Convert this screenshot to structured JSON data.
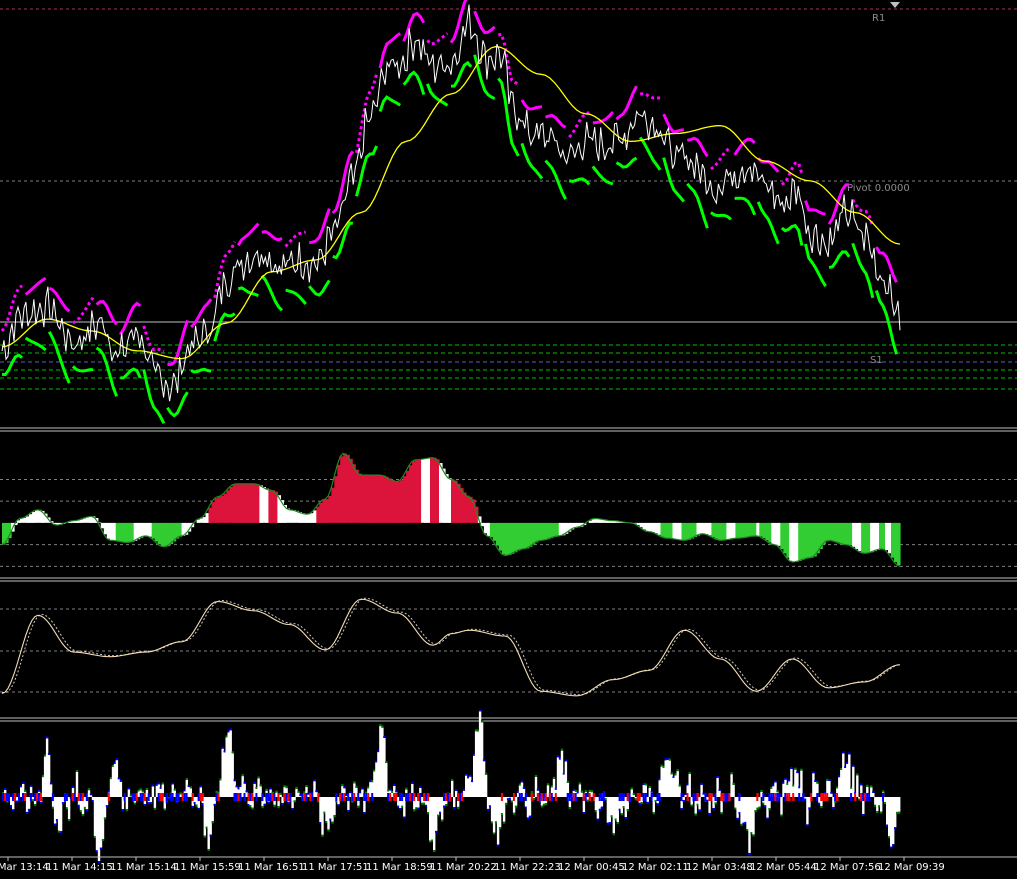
{
  "window": {
    "corner_marker_color": "#c0c0c0"
  },
  "colors": {
    "background": "#000000",
    "price": "#ffffff",
    "ma": "#ffff00",
    "band_up": "#00ff00",
    "band_down": "#ff00ff",
    "osc_pos": "#dc143c",
    "osc_neg": "#32cd32",
    "osc_neutral": "#ffffff",
    "signal_line": "#f5deb3",
    "hist_pos": "#ff0000",
    "hist_neg": "#0000ff",
    "hist_edge": "#008000",
    "grid": "#808080",
    "pivot_dash": "#00c000",
    "separator": "#c0c0c0"
  },
  "chart_data": [
    {
      "type": "line",
      "name": "main-price-panel",
      "levels": [
        {
          "label": "R1"
        },
        {
          "label": "Pivot 0.0000"
        },
        {
          "label": "S1"
        }
      ],
      "x_ticks": [
        "11 Mar 13:14",
        "11 Mar 14:15",
        "11 Mar 15:14",
        "11 Mar 15:59",
        "11 Mar 16:51",
        "11 Mar 17:51",
        "11 Mar 18:59",
        "11 Mar 20:22",
        "11 Mar 22:23",
        "12 Mar 00:45",
        "12 Mar 02:11",
        "12 Mar 03:48",
        "12 Mar 05:44",
        "12 Mar 07:56",
        "12 Mar 09:39"
      ],
      "ylim": [
        0,
        100
      ],
      "price_keys": {
        "x": [
          0,
          0.02,
          0.05,
          0.08,
          0.11,
          0.13,
          0.15,
          0.17,
          0.19,
          0.21,
          0.23,
          0.25,
          0.27,
          0.29,
          0.31,
          0.33,
          0.35,
          0.37,
          0.39,
          0.41,
          0.43,
          0.445,
          0.46,
          0.48,
          0.5,
          0.52,
          0.54,
          0.555,
          0.57,
          0.59,
          0.61,
          0.63,
          0.65,
          0.67,
          0.69,
          0.71,
          0.73,
          0.75,
          0.77,
          0.79,
          0.81,
          0.83,
          0.85,
          0.87,
          0.885,
          0.9,
          0.92,
          0.94,
          0.96,
          0.98,
          1.0
        ],
        "y": [
          15,
          24,
          26,
          17,
          22,
          14,
          20,
          9,
          6,
          16,
          20,
          33,
          38,
          40,
          36,
          38,
          37,
          45,
          58,
          74,
          87,
          88,
          94,
          87,
          88,
          98,
          89,
          90,
          76,
          70,
          69,
          64,
          68,
          67,
          69,
          75,
          72,
          64,
          63,
          56,
          59,
          62,
          57,
          52,
          56,
          45,
          42,
          50,
          44,
          34,
          24
        ]
      },
      "ma_keys": {
        "x": [
          0,
          0.05,
          0.1,
          0.15,
          0.2,
          0.25,
          0.3,
          0.35,
          0.4,
          0.45,
          0.5,
          0.55,
          0.6,
          0.65,
          0.7,
          0.75,
          0.8,
          0.85,
          0.9,
          0.95,
          1.0
        ],
        "y": [
          16,
          23,
          20,
          15,
          13,
          22,
          35,
          38,
          50,
          68,
          80,
          92,
          85,
          75,
          68,
          70,
          72,
          63,
          58,
          50,
          42
        ]
      }
    },
    {
      "type": "area",
      "name": "oscillator-panel-1",
      "ylim": [
        -1.2,
        2.0
      ],
      "guides": [
        1.0,
        0.5,
        -0.5,
        -1.0
      ],
      "keys": {
        "x": [
          0,
          0.02,
          0.04,
          0.06,
          0.08,
          0.1,
          0.12,
          0.14,
          0.16,
          0.18,
          0.2,
          0.22,
          0.24,
          0.26,
          0.28,
          0.3,
          0.32,
          0.34,
          0.36,
          0.38,
          0.4,
          0.42,
          0.44,
          0.46,
          0.48,
          0.5,
          0.52,
          0.54,
          0.56,
          0.58,
          0.6,
          0.62,
          0.64,
          0.66,
          0.68,
          0.7,
          0.72,
          0.74,
          0.76,
          0.78,
          0.8,
          0.82,
          0.84,
          0.86,
          0.88,
          0.9,
          0.92,
          0.94,
          0.96,
          0.98,
          1.0
        ],
        "y": [
          -0.5,
          0.1,
          0.3,
          -0.05,
          0.05,
          0.15,
          -0.4,
          -0.45,
          -0.3,
          -0.55,
          -0.3,
          0.1,
          0.6,
          0.9,
          0.9,
          0.75,
          0.3,
          0.2,
          0.55,
          1.6,
          1.1,
          1.1,
          0.95,
          1.45,
          1.5,
          1.0,
          0.6,
          -0.3,
          -0.75,
          -0.6,
          -0.4,
          -0.3,
          -0.1,
          0.1,
          0.05,
          0.0,
          -0.2,
          -0.35,
          -0.4,
          -0.25,
          -0.4,
          -0.35,
          -0.3,
          -0.5,
          -0.9,
          -0.8,
          -0.4,
          -0.5,
          -0.7,
          -0.6,
          -1.0
        ]
      },
      "neg_bars": [
        0.12,
        0.15,
        0.16,
        0.35,
        0.48,
        0.63,
        0.66,
        0.75,
        0.81,
        0.86,
        0.88,
        0.95,
        0.97,
        0.985
      ],
      "pos_bars": [
        0.29,
        0.31,
        0.315,
        0.325,
        0.47,
        0.49,
        0.495
      ]
    },
    {
      "type": "line",
      "name": "oscillator-panel-2",
      "ylim": [
        0,
        100
      ],
      "guides": [
        80,
        50,
        20
      ],
      "keys": {
        "x": [
          0,
          0.04,
          0.08,
          0.12,
          0.16,
          0.2,
          0.24,
          0.28,
          0.32,
          0.36,
          0.4,
          0.44,
          0.48,
          0.5,
          0.52,
          0.56,
          0.6,
          0.64,
          0.68,
          0.72,
          0.76,
          0.8,
          0.84,
          0.88,
          0.92,
          0.96,
          1.0
        ],
        "y": [
          10,
          78,
          46,
          42,
          46,
          55,
          90,
          82,
          70,
          48,
          92,
          80,
          52,
          62,
          65,
          60,
          12,
          8,
          22,
          30,
          65,
          40,
          12,
          40,
          15,
          20,
          35
        ]
      }
    },
    {
      "type": "bar",
      "name": "histogram-panel",
      "ylim": [
        -1.0,
        1.0
      ],
      "peaks": [
        {
          "x": 0.05,
          "h": 0.7
        },
        {
          "x": 0.12,
          "h": 0.6
        },
        {
          "x": 0.25,
          "h": 0.95
        },
        {
          "x": 0.42,
          "h": 0.9
        },
        {
          "x": 0.53,
          "h": 1.0
        },
        {
          "x": 0.62,
          "h": 0.5
        },
        {
          "x": 0.74,
          "h": 0.55
        },
        {
          "x": 0.88,
          "h": 0.45
        },
        {
          "x": 0.94,
          "h": 0.6
        }
      ],
      "troughs": [
        {
          "x": 0.06,
          "h": 0.55
        },
        {
          "x": 0.11,
          "h": 0.8
        },
        {
          "x": 0.23,
          "h": 0.65
        },
        {
          "x": 0.36,
          "h": 0.45
        },
        {
          "x": 0.48,
          "h": 0.6
        },
        {
          "x": 0.55,
          "h": 0.5
        },
        {
          "x": 0.68,
          "h": 0.45
        },
        {
          "x": 0.83,
          "h": 0.55
        },
        {
          "x": 0.99,
          "h": 0.65
        }
      ]
    }
  ]
}
